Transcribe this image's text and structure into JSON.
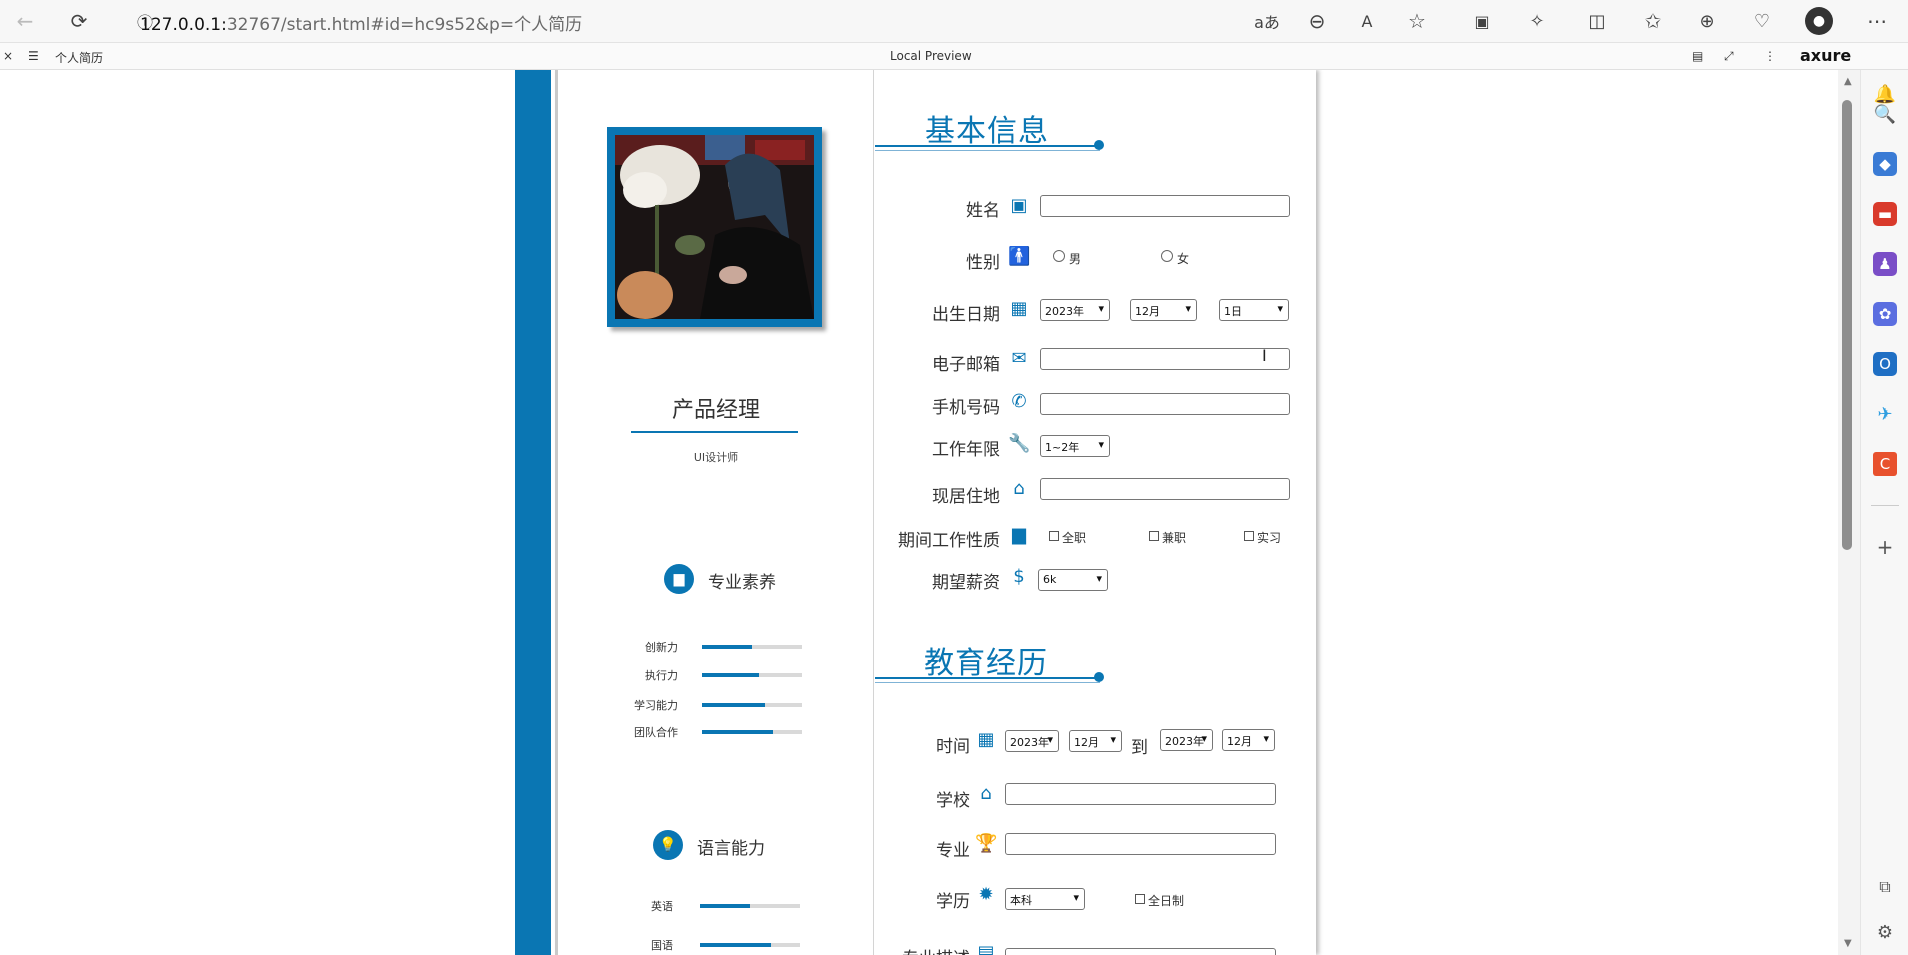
{
  "browser": {
    "url_host": "127.0.0.1:",
    "url_rest": "32767/start.html#id=hc9s52&p=个人简历",
    "info_icon": "info-icon"
  },
  "axure": {
    "page_name": "个人简历",
    "preview_label": "Local Preview",
    "brand": "axure"
  },
  "profile": {
    "job_title": "产品经理",
    "subtitle": "UI设计师"
  },
  "skills": {
    "heading": "专业素养",
    "items": [
      {
        "label": "创新力",
        "level": 0.5
      },
      {
        "label": "执行力",
        "level": 0.57
      },
      {
        "label": "学习能力",
        "level": 0.63
      },
      {
        "label": "团队合作",
        "level": 0.71
      }
    ]
  },
  "languages": {
    "heading": "语言能力",
    "items": [
      {
        "label": "英语",
        "level": 0.5
      },
      {
        "label": "国语",
        "level": 0.71
      }
    ]
  },
  "basic": {
    "heading": "基本信息",
    "name_label": "姓名",
    "gender_label": "性别",
    "gender_male": "男",
    "gender_female": "女",
    "birth_label": "出生日期",
    "birth_year": "2023年",
    "birth_month": "12月",
    "birth_day": "1日",
    "email_label": "电子邮箱",
    "phone_label": "手机号码",
    "years_label": "工作年限",
    "years_value": "1~2年",
    "address_label": "现居住地",
    "worktype_label": "期间工作性质",
    "worktype_full": "全职",
    "worktype_part": "兼职",
    "worktype_intern": "实习",
    "salary_label": "期望薪资",
    "salary_value": "6k"
  },
  "education": {
    "heading": "教育经历",
    "time_label": "时间",
    "from_year": "2023年",
    "from_month": "12月",
    "to_label": "到",
    "to_year": "2023年",
    "to_month": "12月",
    "school_label": "学校",
    "major_label": "专业",
    "degree_label": "学历",
    "degree_value": "本科",
    "fulltime_label": "全日制",
    "desc_label": "专业描述"
  },
  "colors": {
    "accent": "#0a76b3"
  }
}
